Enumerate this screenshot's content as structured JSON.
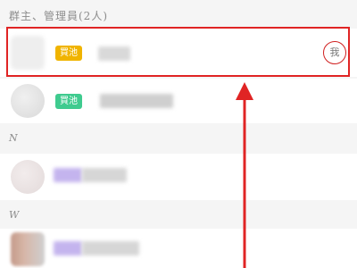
{
  "section_admins": {
    "title": "群主、管理員(2人)"
  },
  "members": [
    {
      "badge": "買池",
      "badge_color": "#f0b400",
      "me": "我"
    },
    {
      "badge": "買池",
      "badge_color": "#3fcb8f"
    }
  ],
  "section_n": {
    "letter": "N"
  },
  "section_w": {
    "letter": "W"
  },
  "annotation_color": "#e02424"
}
